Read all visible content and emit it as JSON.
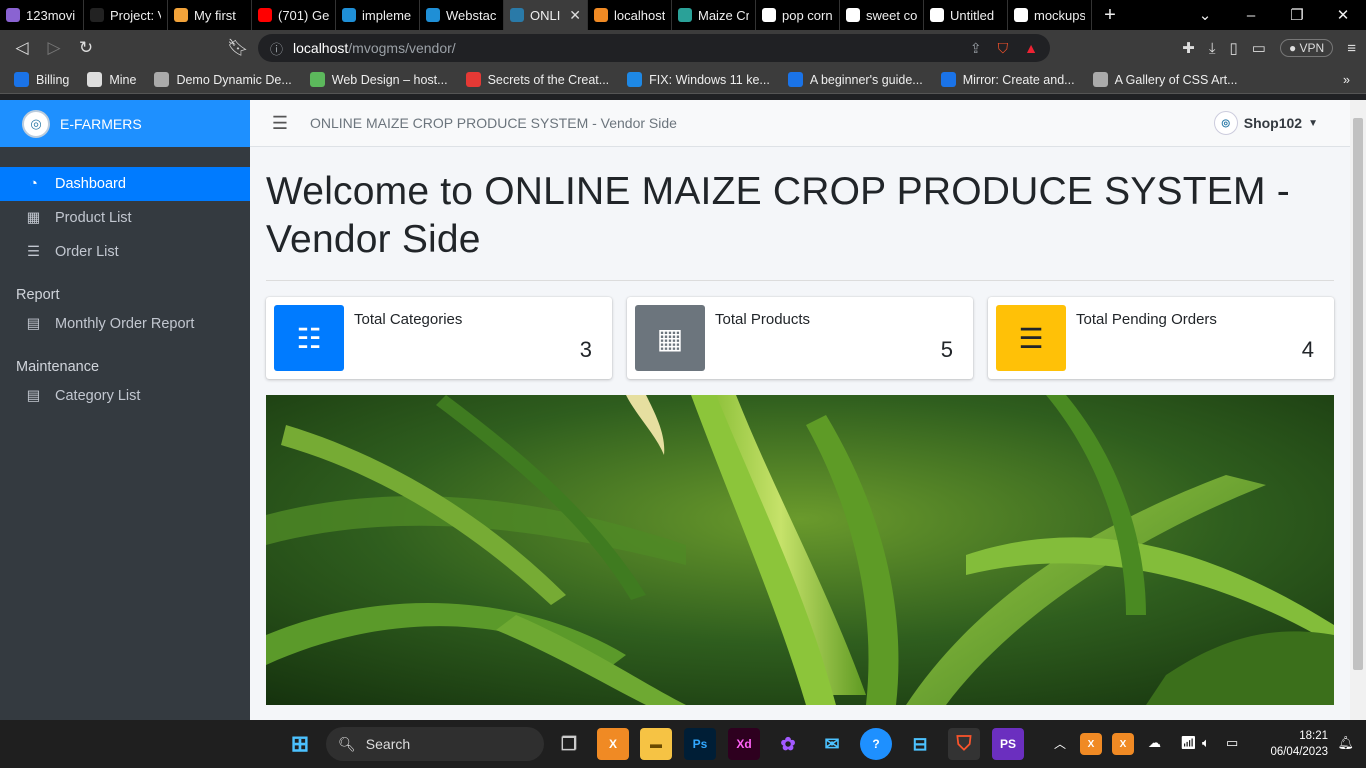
{
  "browser": {
    "tabs": [
      {
        "title": "123movi",
        "icon_color": "#8a63d2",
        "icon": "ghost-icon"
      },
      {
        "title": "Project: V",
        "icon_color": "#222",
        "icon": "generic-icon"
      },
      {
        "title": "My first",
        "icon_color": "#f2a33a",
        "icon": "firefox-icon"
      },
      {
        "title": "(701) Get",
        "icon_color": "#ff0000",
        "icon": "youtube-icon"
      },
      {
        "title": "impleme",
        "icon_color": "#1f8fd6",
        "icon": "trello-icon"
      },
      {
        "title": "Webstac",
        "icon_color": "#1f8fd6",
        "icon": "trello-icon"
      },
      {
        "title": "ONLI",
        "icon_color": "#2a7aa8",
        "icon": "efarmers-icon",
        "active": true
      },
      {
        "title": "localhost",
        "icon_color": "#f08a24",
        "icon": "xampp-icon"
      },
      {
        "title": "Maize Cr",
        "icon_color": "#2aa198",
        "icon": "d-icon"
      },
      {
        "title": "pop corn",
        "icon_color": "#fff",
        "icon": "google-icon"
      },
      {
        "title": "sweet co",
        "icon_color": "#fff",
        "icon": "google-icon"
      },
      {
        "title": "Untitled",
        "icon_color": "#fff",
        "icon": "notion-icon"
      },
      {
        "title": "mockups",
        "icon_color": "#fff",
        "icon": "google-icon"
      }
    ],
    "url_host": "localhost",
    "url_path": "/mvogms/vendor/",
    "vpn_label": "VPN",
    "bookmarks": [
      {
        "label": "Billing",
        "icon": "wifi-icon",
        "color": "#1a73e8"
      },
      {
        "label": "Mine",
        "icon": "pattern-icon",
        "color": "#ddd"
      },
      {
        "label": "Demo Dynamic De...",
        "icon": "globe-icon",
        "color": "#aaa"
      },
      {
        "label": "Web Design – host...",
        "icon": "leaf-icon",
        "color": "#5cb85c"
      },
      {
        "label": "Secrets of the Creat...",
        "icon": "a-icon",
        "color": "#e53935"
      },
      {
        "label": "FIX: Windows 11 ke...",
        "icon": "w-icon",
        "color": "#1e88e5"
      },
      {
        "label": "A beginner's guide...",
        "icon": "mirror-icon",
        "color": "#1a73e8"
      },
      {
        "label": "Mirror: Create and...",
        "icon": "mirror-icon",
        "color": "#1a73e8"
      },
      {
        "label": "A Gallery of CSS Art...",
        "icon": "globe-icon",
        "color": "#aaa"
      }
    ]
  },
  "app": {
    "brand": "E-FARMERS",
    "header_title": "ONLINE MAIZE CROP PRODUCE SYSTEM - Vendor Side",
    "user_name": "Shop102",
    "menu": [
      {
        "label": "Dashboard",
        "icon": "dashboard-icon",
        "active": true
      },
      {
        "label": "Product List",
        "icon": "boxes-icon"
      },
      {
        "label": "Order List",
        "icon": "list-icon"
      }
    ],
    "report_heading": "Report",
    "report_items": [
      {
        "label": "Monthly Order Report",
        "icon": "file-icon"
      }
    ],
    "maintenance_heading": "Maintenance",
    "maintenance_items": [
      {
        "label": "Category List",
        "icon": "table-icon"
      }
    ],
    "welcome": "Welcome to ONLINE MAIZE CROP PRODUCE SYSTEM - Vendor Side",
    "cards": [
      {
        "label": "Total Categories",
        "value": "3",
        "color": "#007bff",
        "icon": "th-list-icon"
      },
      {
        "label": "Total Products",
        "value": "5",
        "color": "#6c757d",
        "icon": "boxes-icon"
      },
      {
        "label": "Total Pending Orders",
        "value": "4",
        "color": "#ffc107",
        "icon": "list-icon"
      }
    ]
  },
  "taskbar": {
    "search_label": "Search",
    "time": "18:21",
    "date": "06/04/2023"
  }
}
